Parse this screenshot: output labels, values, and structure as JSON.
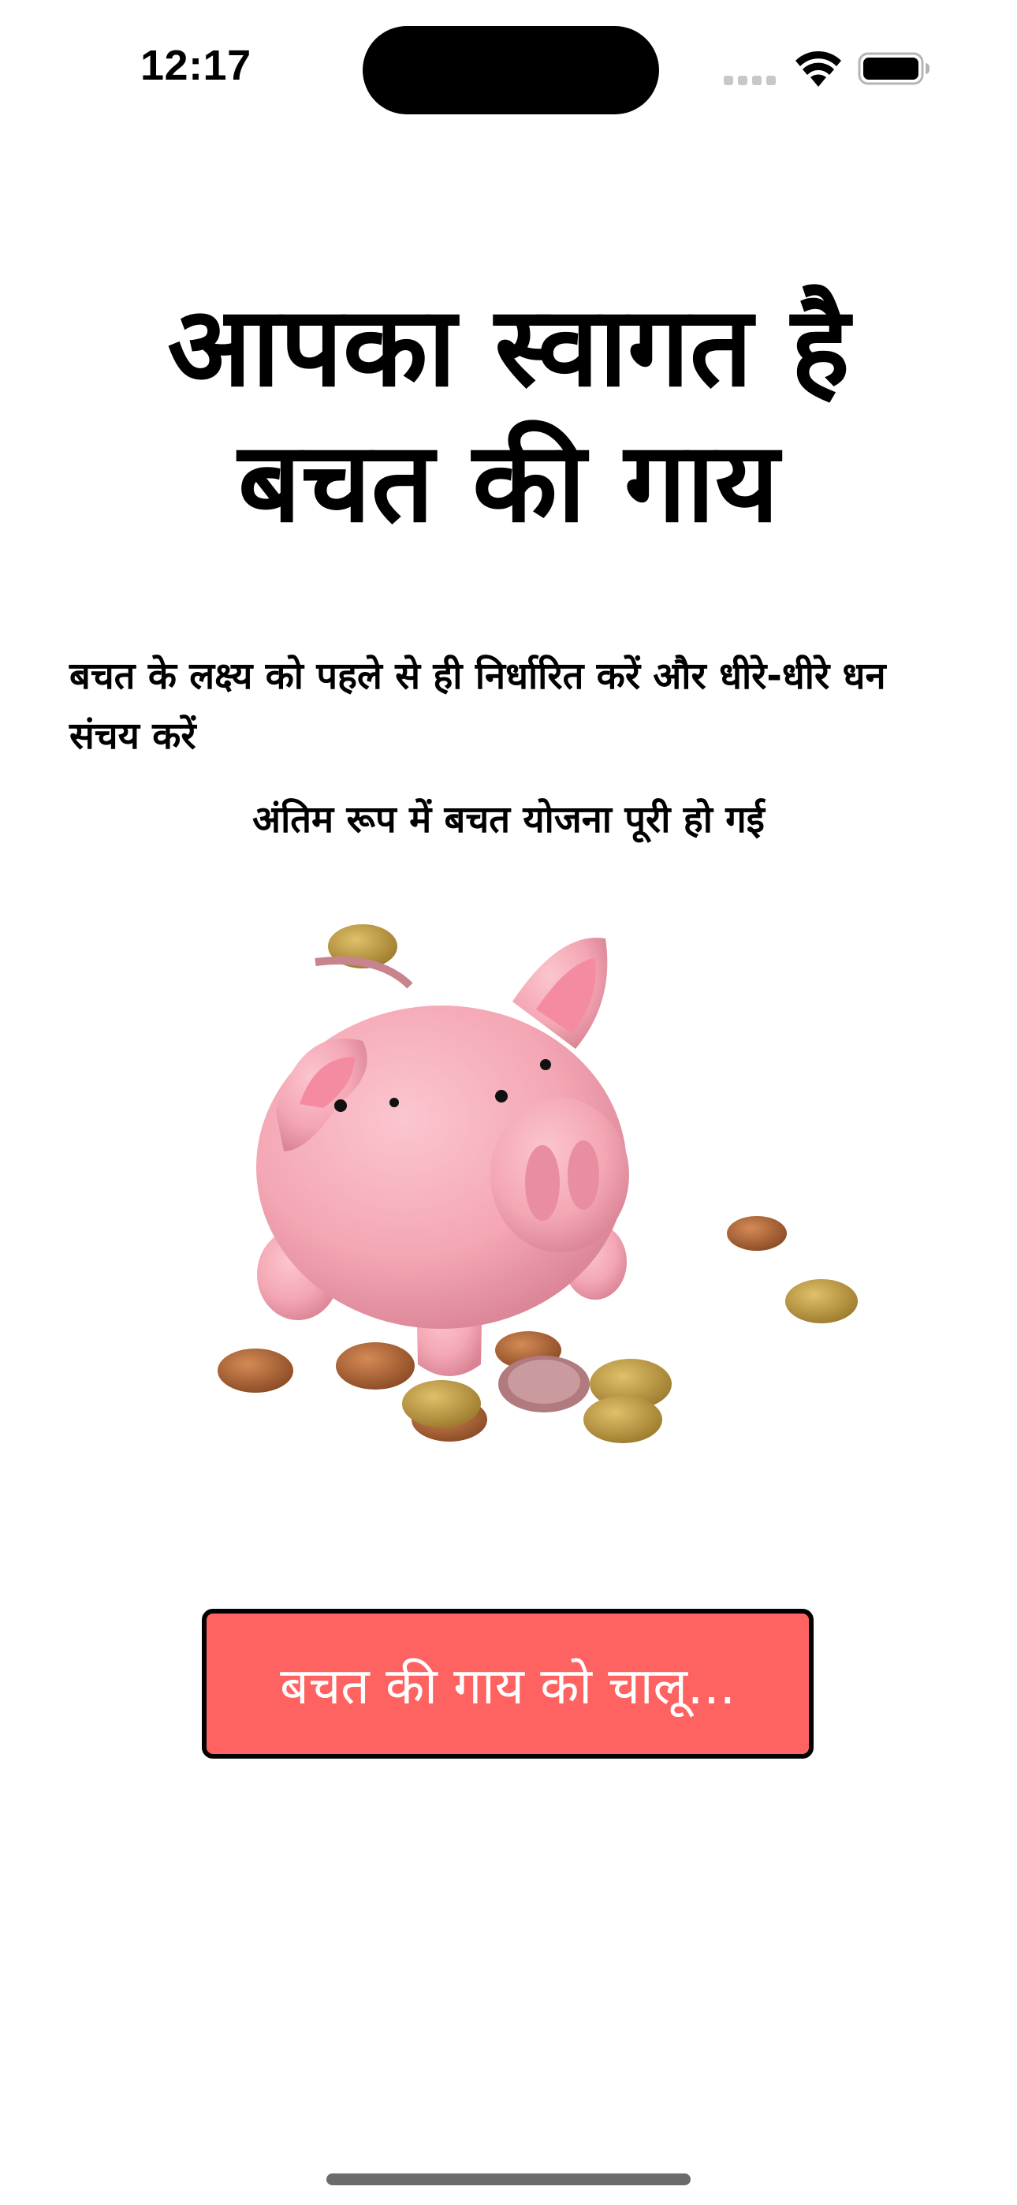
{
  "status_bar": {
    "time": "12:17",
    "signal_icon": "cellular-signal-icon",
    "wifi_icon": "wifi-icon",
    "battery_icon": "battery-full-icon"
  },
  "welcome": {
    "title_line1": "आपका स्वागत है",
    "title_line2": "बचत की गाय",
    "description": "बचत के लक्ष्य को पहले से ही निर्धारित करें और धीरे-धीरे धन संचय करें",
    "subnote": "अंतिम रूप में बचत योजना पूरी हो गई"
  },
  "illustration": {
    "icon": "piggy-bank-with-coins-icon"
  },
  "start_button": {
    "label": "बचत की गाय को चालू...",
    "color": "#ff6361"
  },
  "colors": {
    "piggy_pink": "#f4a7b4",
    "coin_copper": "#b0683a",
    "coin_gold": "#c9a24a"
  }
}
